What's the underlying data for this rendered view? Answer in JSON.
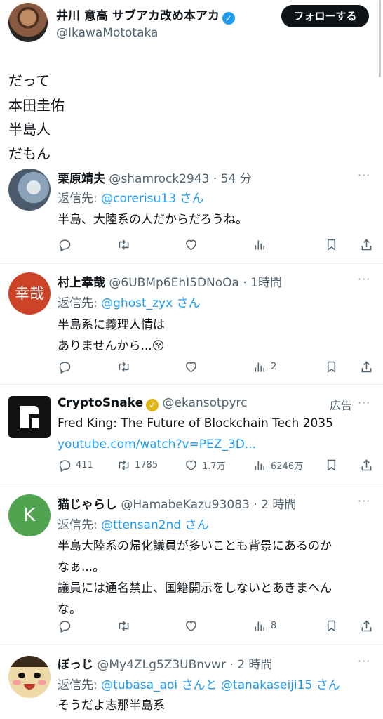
{
  "header": {
    "name": "井川 意高 サブアカ改め本アカ",
    "handle": "@IkawaMototaka",
    "follow_label": "フォローする"
  },
  "main_tweet": {
    "lines": [
      "だって",
      "本田圭佑",
      "半島人",
      "だもん"
    ]
  },
  "replies": [
    {
      "name": "栗原靖夫",
      "handle": "@shamrock2943",
      "time": "· 54 分",
      "replyto_prefix": "返信先: ",
      "replyto": "@corerisu13 さん",
      "body": [
        "半島、大陸系の人だからだろうね。"
      ],
      "counts": {
        "reply": "",
        "retweet": "",
        "like": "",
        "views": ""
      }
    },
    {
      "name": "村上幸哉",
      "handle": "@6UBMp6EhI5DNoOa",
      "time": "· 1時間",
      "avatar_text": "幸哉",
      "replyto_prefix": "返信先: ",
      "replyto": "@ghost_zyx さん",
      "body": [
        "半島系に義理人情は",
        "ありませんから...😚"
      ],
      "counts": {
        "reply": "",
        "retweet": "",
        "like": "",
        "views": "2"
      }
    },
    {
      "name": "CryptoSnake",
      "handle": "@ekansotpyrc",
      "ad_label": "広告",
      "body": [
        "Fred King: The Future of Blockchain Tech 2035"
      ],
      "link": "youtube.com/watch?v=PEZ_3D...",
      "counts": {
        "reply": "411",
        "retweet": "1785",
        "like": "1.7万",
        "views": "6246万"
      }
    },
    {
      "name": "猫じゃらし",
      "handle": "@HamabeKazu93083",
      "time": "· 2 時間",
      "avatar_text": "K",
      "replyto_prefix": "返信先: ",
      "replyto": "@ttensan2nd さん",
      "body": [
        "半島大陸系の帰化議員が多いことも背景にあるのか",
        "なぁ...。",
        "議員には通名禁止、国籍開示をしないとあきまへん",
        "な。"
      ],
      "counts": {
        "reply": "",
        "retweet": "",
        "like": "",
        "views": "8"
      }
    },
    {
      "name": "ぼっじ",
      "handle": "@My4ZLg5Z3UBnvwr",
      "time": "· 2 時間",
      "replyto_prefix": "返信先: ",
      "replyto": "@tubasa_aoi さんと @tanakaseiji15 さん",
      "body": [
        "そうだよ志那半島系"
      ]
    }
  ],
  "more_label": "···",
  "colors": {
    "accent": "#1d9bf0",
    "text": "#0f1419",
    "muted": "#536471",
    "verified": "#1d9bf0",
    "verified_gold": "#e2b719"
  },
  "icons": [
    "reply-icon",
    "retweet-icon",
    "like-icon",
    "views-icon",
    "bookmark-icon",
    "share-icon",
    "verified-icon",
    "more-icon"
  ]
}
